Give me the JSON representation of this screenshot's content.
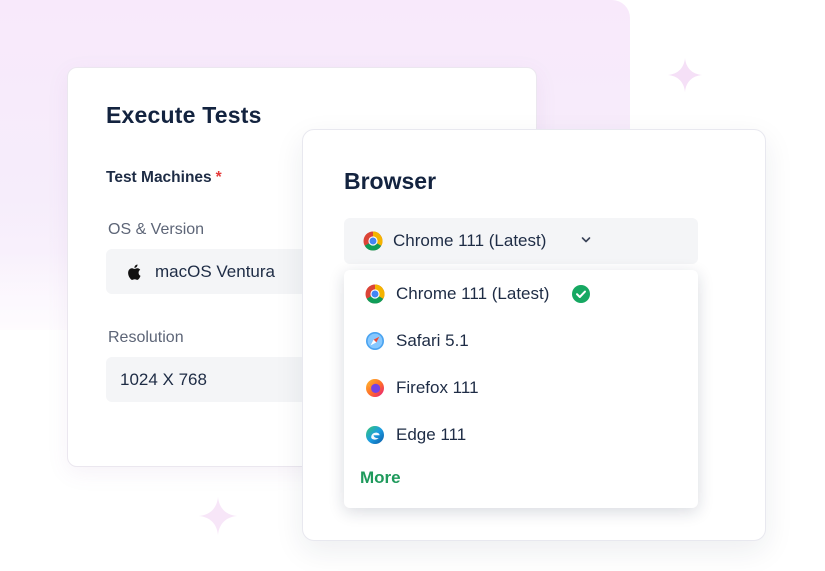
{
  "execute_card": {
    "title": "Execute Tests",
    "machines_label": "Test Machines",
    "required_mark": "*",
    "os_label": "OS & Version",
    "os_value": "macOS Ventura",
    "resolution_label": "Resolution",
    "resolution_value": "1024 X 768"
  },
  "browser_card": {
    "title": "Browser",
    "selected": "Chrome 111 (Latest)",
    "options": [
      {
        "label": "Chrome 111 (Latest)",
        "icon": "chrome-icon",
        "checked": true
      },
      {
        "label": "Safari 5.1",
        "icon": "safari-icon",
        "checked": false
      },
      {
        "label": "Firefox 111",
        "icon": "firefox-icon",
        "checked": false
      },
      {
        "label": "Edge 111",
        "icon": "edge-icon",
        "checked": false
      }
    ],
    "more_label": "More"
  },
  "colors": {
    "accent_green": "#1f9a5c",
    "check_green": "#16a862",
    "required_red": "#e53b3b",
    "title_navy": "#13233f",
    "field_bg": "#f4f5f7"
  }
}
